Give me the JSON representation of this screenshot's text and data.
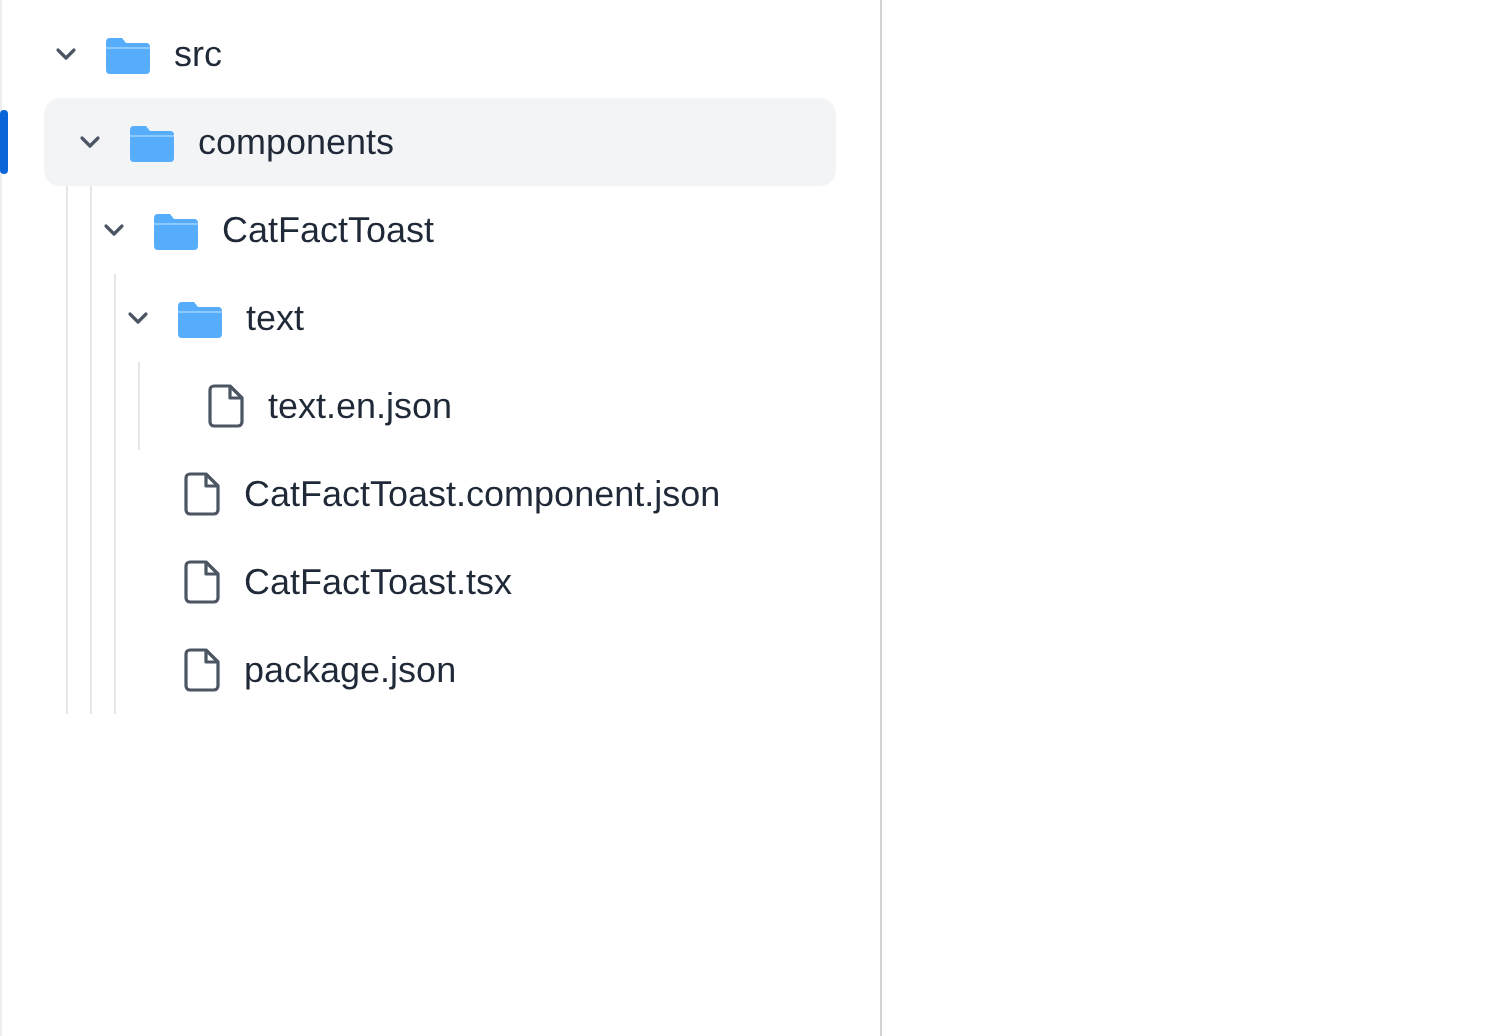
{
  "tree": [
    {
      "name": "src",
      "kind": "folder",
      "expanded": true,
      "selected": false,
      "children": [
        {
          "name": "components",
          "kind": "folder",
          "expanded": true,
          "selected": true,
          "children": [
            {
              "name": "CatFactToast",
              "kind": "folder",
              "expanded": true,
              "selected": false,
              "children": [
                {
                  "name": "text",
                  "kind": "folder",
                  "expanded": true,
                  "selected": false,
                  "children": [
                    {
                      "name": "text.en.json",
                      "kind": "file",
                      "selected": false
                    }
                  ]
                },
                {
                  "name": "CatFactToast.component.json",
                  "kind": "file",
                  "selected": false
                },
                {
                  "name": "CatFactToast.tsx",
                  "kind": "file",
                  "selected": false
                },
                {
                  "name": "package.json",
                  "kind": "file",
                  "selected": false
                }
              ]
            }
          ]
        }
      ]
    }
  ]
}
